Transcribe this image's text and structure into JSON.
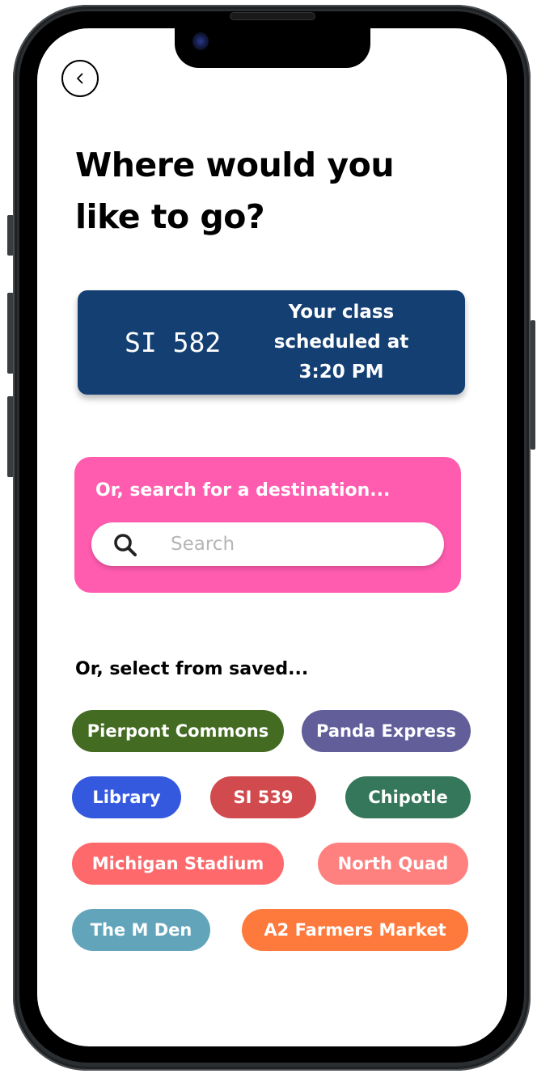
{
  "header": {
    "back_label": "Back",
    "title": "Where would you like to go?"
  },
  "class_card": {
    "course_code": "SI 582",
    "schedule_text": "Your class scheduled at 3:20 PM",
    "background": "#143f73"
  },
  "search": {
    "heading": "Or, search for a destination...",
    "placeholder": "Search",
    "value": "",
    "background": "#ff5caf"
  },
  "saved": {
    "heading": "Or, select from saved...",
    "chips": [
      {
        "label": "Pierpont Commons",
        "color": "#436b22"
      },
      {
        "label": "Panda Express",
        "color": "#625e9a"
      },
      {
        "label": "Library",
        "color": "#3459de"
      },
      {
        "label": "SI 539",
        "color": "#d14a4d"
      },
      {
        "label": "Chipotle",
        "color": "#34775a"
      },
      {
        "label": "Michigan Stadium",
        "color": "#fe6a6c"
      },
      {
        "label": "North Quad",
        "color": "#fe8180"
      },
      {
        "label": "The M Den",
        "color": "#62a5bb"
      },
      {
        "label": "A2 Farmers Market",
        "color": "#fd7a3c"
      }
    ]
  }
}
